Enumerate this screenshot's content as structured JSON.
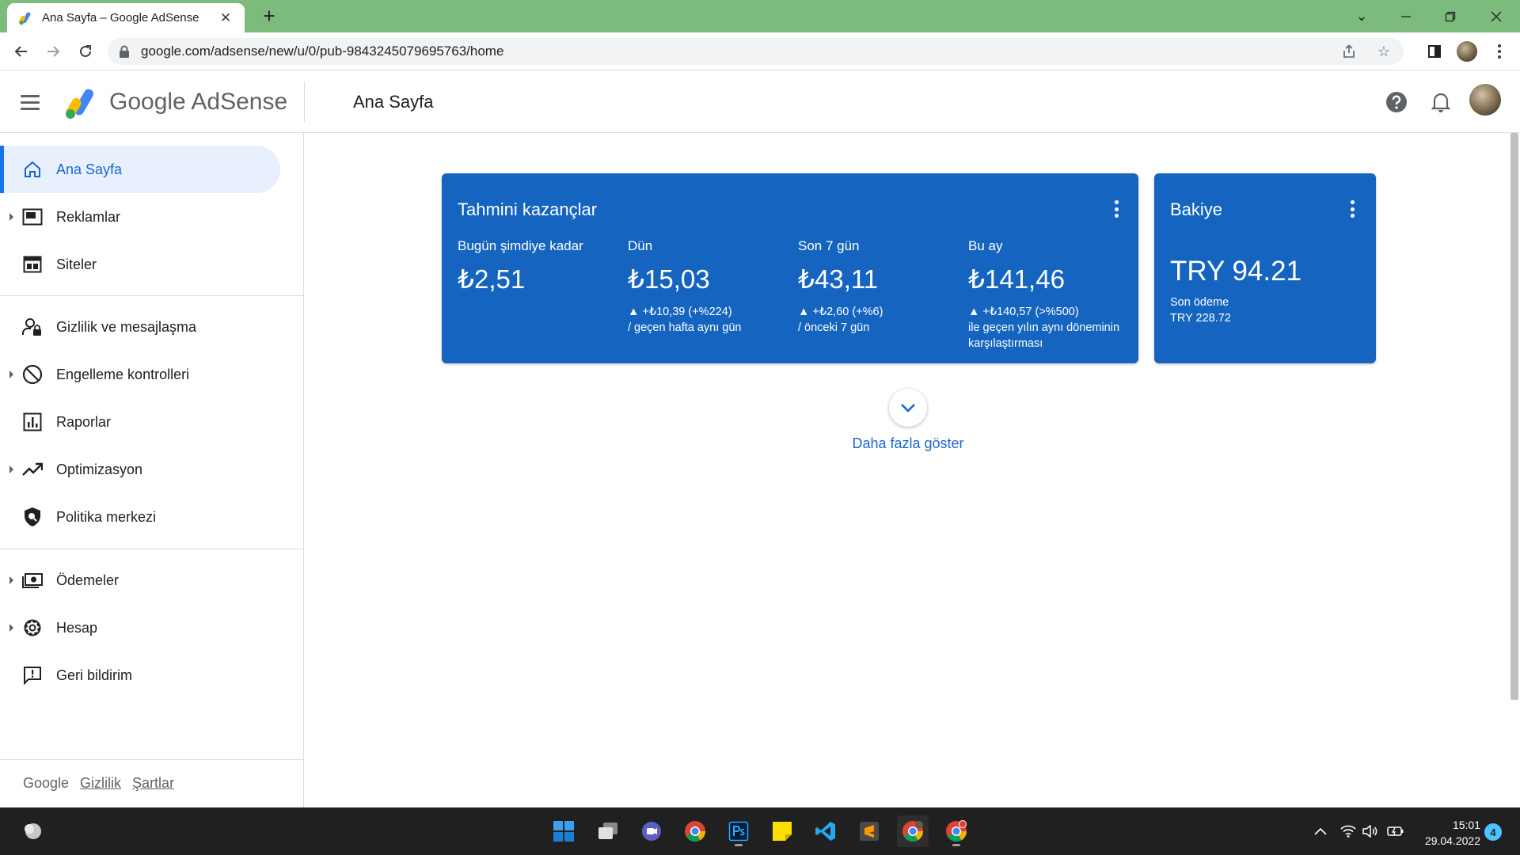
{
  "browser": {
    "tab_title": "Ana Sayfa – Google AdSense",
    "tab_close": "✕",
    "new_tab": "+",
    "url": "google.com/adsense/new/u/0/pub-9843245079695763/home"
  },
  "header": {
    "brand": "Google AdSense",
    "page_title": "Ana Sayfa"
  },
  "sidebar": {
    "items": [
      {
        "label": "Ana Sayfa"
      },
      {
        "label": "Reklamlar"
      },
      {
        "label": "Siteler"
      },
      {
        "label": "Gizlilik ve mesajlaşma"
      },
      {
        "label": "Engelleme kontrolleri"
      },
      {
        "label": "Raporlar"
      },
      {
        "label": "Optimizasyon"
      },
      {
        "label": "Politika merkezi"
      },
      {
        "label": "Ödemeler"
      },
      {
        "label": "Hesap"
      },
      {
        "label": "Geri bildirim"
      }
    ],
    "footer": {
      "google": "Google",
      "privacy": "Gizlilik",
      "terms": "Şartlar"
    }
  },
  "earnings": {
    "title": "Tahmini kazançlar",
    "metrics": [
      {
        "label": "Bugün şimdiye kadar",
        "value": "₺2,51",
        "delta": "",
        "note": ""
      },
      {
        "label": "Dün",
        "value": "₺15,03",
        "delta": "▲ +₺10,39 (+%224)",
        "note": "/ geçen hafta aynı gün"
      },
      {
        "label": "Son 7 gün",
        "value": "₺43,11",
        "delta": "▲ +₺2,60 (+%6)",
        "note": "/ önceki 7 gün"
      },
      {
        "label": "Bu ay",
        "value": "₺141,46",
        "delta": "▲ +₺140,57 (>%500)",
        "note": "ile geçen yılın aynı döneminin karşılaştırması"
      }
    ]
  },
  "balance": {
    "title": "Bakiye",
    "value": "TRY 94.21",
    "last_payment_label": "Son ödeme",
    "last_payment_value": "TRY 228.72"
  },
  "show_more": "Daha fazla göster",
  "taskbar": {
    "time": "15:01",
    "date": "29.04.2022",
    "notifications": "4"
  },
  "colors": {
    "card_blue": "#1565c0",
    "accent": "#1a73e8",
    "tabstrip": "#7dbb7d"
  }
}
